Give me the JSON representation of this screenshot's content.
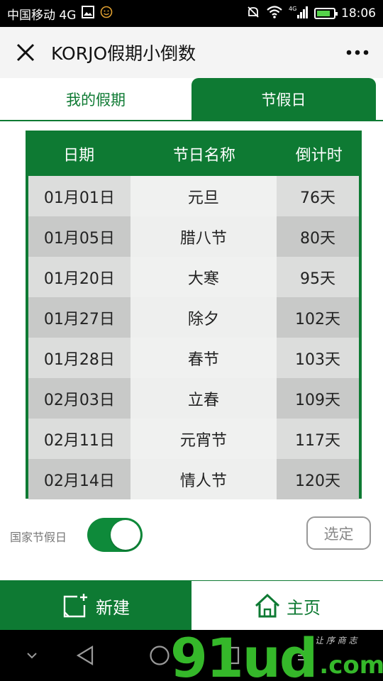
{
  "status_bar": {
    "carrier": "中国移动 4G",
    "network_badge": "4G",
    "time": "18:06",
    "battery_level": 0.7
  },
  "title_bar": {
    "title": "KORJO假期小倒数",
    "close_icon": "close-icon",
    "more_icon": "more-icon"
  },
  "tabs": [
    {
      "label": "我的假期",
      "active": false
    },
    {
      "label": "节假日",
      "active": true
    }
  ],
  "table": {
    "headers": [
      "日期",
      "节日名称",
      "倒计时"
    ],
    "rows": [
      {
        "date": "01月01日",
        "name": "元旦",
        "countdown": "76天"
      },
      {
        "date": "01月05日",
        "name": "腊八节",
        "countdown": "80天"
      },
      {
        "date": "01月20日",
        "name": "大寒",
        "countdown": "95天"
      },
      {
        "date": "01月27日",
        "name": "除夕",
        "countdown": "102天"
      },
      {
        "date": "01月28日",
        "name": "春节",
        "countdown": "103天"
      },
      {
        "date": "02月03日",
        "name": "立春",
        "countdown": "109天"
      },
      {
        "date": "02月11日",
        "name": "元宵节",
        "countdown": "117天"
      },
      {
        "date": "02月14日",
        "name": "情人节",
        "countdown": "120天"
      }
    ]
  },
  "controls": {
    "national_holiday_label": "国家节假日",
    "national_holiday_on": true,
    "select_button": "选定"
  },
  "bottom_nav": {
    "new_label": "新建",
    "home_label": "主页"
  },
  "watermark": {
    "brand": "91ud",
    "domain": ".com",
    "tagline": "让 序 商 志"
  },
  "colors": {
    "primary_green": "#0e7a33",
    "switch_green": "#0e8a3a",
    "watermark_green": "#35b82a"
  }
}
